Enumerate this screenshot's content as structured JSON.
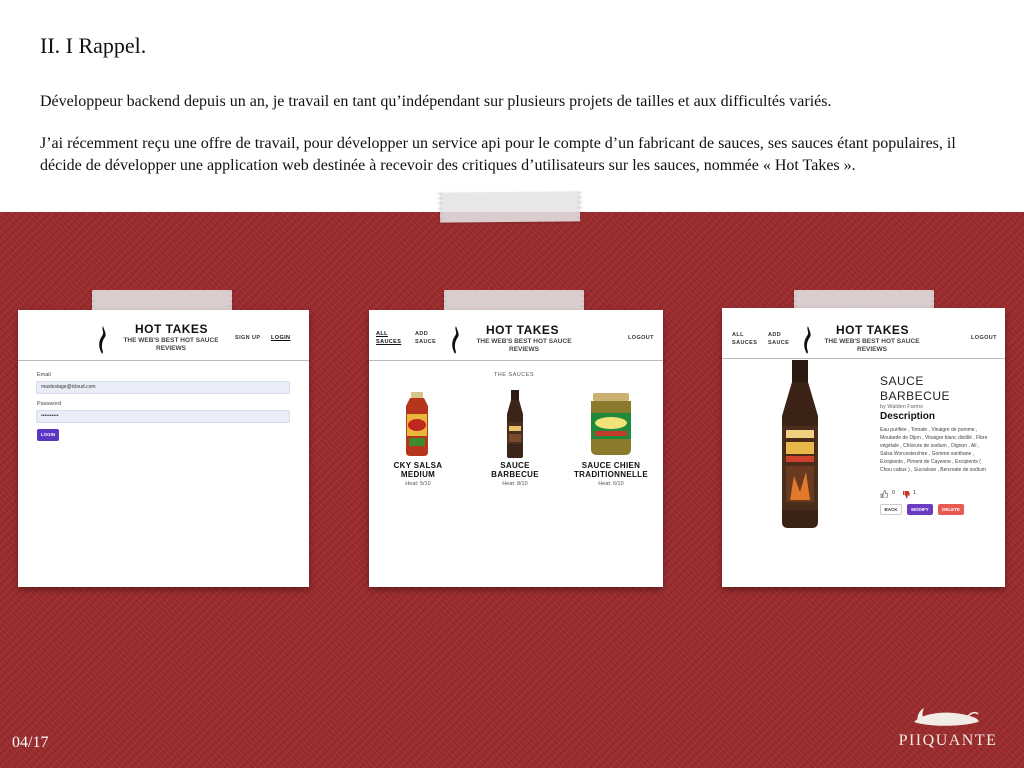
{
  "slide": {
    "title": "II. I Rappel.",
    "paragraph1": "Développeur backend depuis un an, je travail en tant qu’indépendant sur plusieurs projets de tailles et aux difficultés variés.",
    "paragraph2": "J’ai récemment reçu une offre de travail, pour développer un service api pour le compte d’un fabricant de sauces, ses sauces étant populaires, il décide de développer une application web destinée à recevoir des critiques d’utilisateurs sur les sauces, nommée « Hot Takes ».",
    "page_number": "04/17",
    "brand": "PIIQUANTE"
  },
  "app": {
    "title": "HOT TAKES",
    "subtitle": "THE WEB'S BEST HOT SAUCE REVIEWS"
  },
  "login_screen": {
    "nav": {
      "signup": "SIGN UP",
      "login": "LOGIN"
    },
    "email_label": "Email",
    "email_value": "maxlestage@icloud.com",
    "password_label": "Password",
    "password_value": "••••••••••",
    "login_button": "LOGIN"
  },
  "list_screen": {
    "nav": {
      "all_sauces": "ALL SAUCES",
      "add_sauce": "ADD SAUCE",
      "logout": "LOGOUT"
    },
    "heading": "THE SAUCES",
    "sauces": [
      {
        "name": "CKY SALSA MEDIUM",
        "heat": "Heat: 5/10"
      },
      {
        "name": "SAUCE BARBECUE",
        "heat": "Heat: 8/10"
      },
      {
        "name": "SAUCE CHIEN TRADITIONNELLE",
        "heat": "Heat: 6/10"
      }
    ]
  },
  "detail_screen": {
    "nav": {
      "all_sauces": "ALL SAUCES",
      "add_sauce": "ADD SAUCE",
      "logout": "LOGOUT"
    },
    "name": "SAUCE BARBECUE",
    "by": "by Walden Farms",
    "description_heading": "Description",
    "description": "Eau purifiée , Tomate , Vinaigre de pomme , Moutarde de Dijon , Vinaigre blanc distillé , Fibre végétale , Chlorure de sodium , Oignon , Ail , Salsa Worcestershire , Gomme xanthane , Excipients , Piment de Cayenne , Excipients ( Chou cabus ) , Sucralose , Benzoate de sodium",
    "likes": "0",
    "dislikes": "1",
    "back_button": "BACK",
    "modify_button": "MODIFY",
    "delete_button": "DELETE",
    "colors": {
      "modify": "#6a3cc2",
      "delete": "#e65a4f",
      "dislike_icon": "#c0392b"
    }
  },
  "colors": {
    "board": "#9b2a2c",
    "login_button": "#5b35c4",
    "input_bg": "#e8edf7"
  }
}
